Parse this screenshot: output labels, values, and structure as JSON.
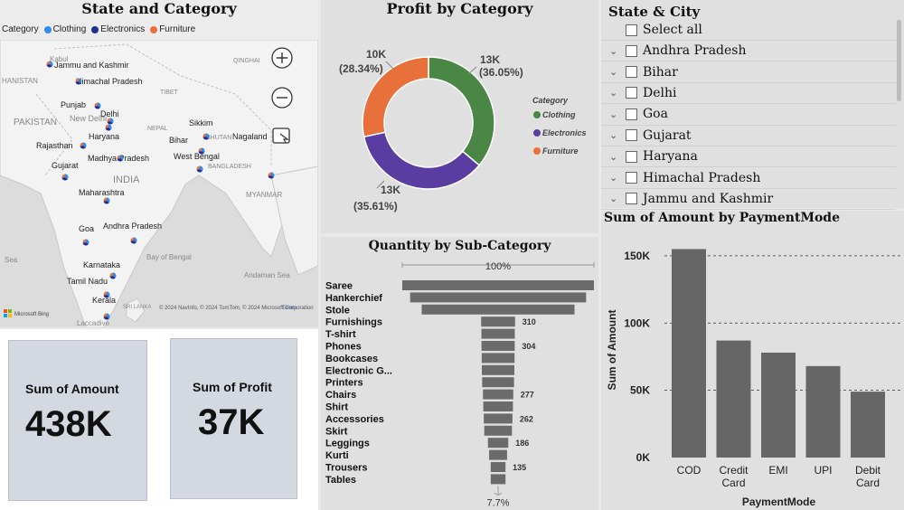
{
  "map": {
    "title": "State and Category",
    "legend_label": "Category",
    "legend": [
      {
        "name": "Clothing",
        "color": "#2d8cf0"
      },
      {
        "name": "Electronics",
        "color": "#1f2e8c"
      },
      {
        "name": "Furniture",
        "color": "#e8703a"
      }
    ],
    "geo_labels": [
      "Kabul",
      "HANISTAN",
      "PAKISTAN",
      "New Delhi",
      "NEPAL",
      "TIBET",
      "QINGHAI",
      "BHUTAN",
      "BANGLADESH",
      "INDIA",
      "MYANMAR",
      "Sea",
      "Bay of Bengal",
      "Andaman Sea",
      "SRI LANKA",
      "Laccadive"
    ],
    "state_labels": [
      "Jammu and Kashmir",
      "Himachal Pradesh",
      "Punjab",
      "Delhi",
      "Haryana",
      "Rajasthan",
      "Gujarat",
      "Madhya Pradesh",
      "Maharashtra",
      "Goa",
      "Andhra Pradesh",
      "Karnataka",
      "Tamil Nadu",
      "Kerala",
      "Sikkim",
      "Bihar",
      "West Bengal",
      "Nagaland"
    ],
    "attribution": "© 2024 NavInfo, © 2024 TomTom, © 2024 Microsoft Corporation",
    "terms": "Terms",
    "bing": "Microsoft Bing"
  },
  "cards": [
    {
      "label": "Sum of Amount",
      "value": "438K"
    },
    {
      "label": "Sum of Profit",
      "value": "37K"
    }
  ],
  "donut": {
    "title": "Profit by Category",
    "legend_title": "Category",
    "slices": [
      {
        "name": "Clothing",
        "value_label": "13K",
        "pct_label": "(36.05%)",
        "pct": 36.05,
        "color": "#4a8745"
      },
      {
        "name": "Electronics",
        "value_label": "13K",
        "pct_label": "(35.61%)",
        "pct": 35.61,
        "color": "#5a3da0"
      },
      {
        "name": "Furniture",
        "value_label": "10K",
        "pct_label": "(28.34%)",
        "pct": 28.34,
        "color": "#e8703a"
      }
    ]
  },
  "slicer": {
    "title": "State & City",
    "select_all": "Select all",
    "items": [
      "Andhra Pradesh",
      "Bihar",
      "Delhi",
      "Goa",
      "Gujarat",
      "Haryana",
      "Himachal Pradesh",
      "Jammu and Kashmir"
    ]
  },
  "chart_data": [
    {
      "type": "bar",
      "title": "Quantity by Sub-Category",
      "orientation": "funnel",
      "categories": [
        "Saree",
        "Hankerchief",
        "Stole",
        "Furnishings",
        "T-shirt",
        "Phones",
        "Bookcases",
        "Electronic G...",
        "Printers",
        "Chairs",
        "Shirt",
        "Accessories",
        "Skirt",
        "Leggings",
        "Kurti",
        "Trousers",
        "Tables"
      ],
      "values": [
        1751,
        1608,
        1396,
        310,
        305,
        304,
        300,
        297,
        291,
        277,
        271,
        262,
        253,
        186,
        164,
        135,
        135
      ],
      "data_labels": {
        "Furnishings": "310",
        "Phones": "304",
        "Electronic G...": "297",
        "Chairs": "277",
        "Accessories": "262",
        "Leggings": "186",
        "Trousers": "135"
      },
      "top_label": "100%",
      "bottom_label": "7.7%"
    },
    {
      "type": "bar",
      "title": "Sum of Amount by PaymentMode",
      "categories": [
        "COD",
        "Credit Card",
        "EMI",
        "UPI",
        "Debit Card"
      ],
      "values": [
        155000,
        87000,
        78000,
        68000,
        49000
      ],
      "xlabel": "PaymentMode",
      "ylabel": "Sum of Amount",
      "yticks": [
        "0K",
        "50K",
        "100K",
        "150K"
      ],
      "ylim": [
        0,
        160000
      ],
      "bar_color": "#666666",
      "grid": true
    }
  ]
}
